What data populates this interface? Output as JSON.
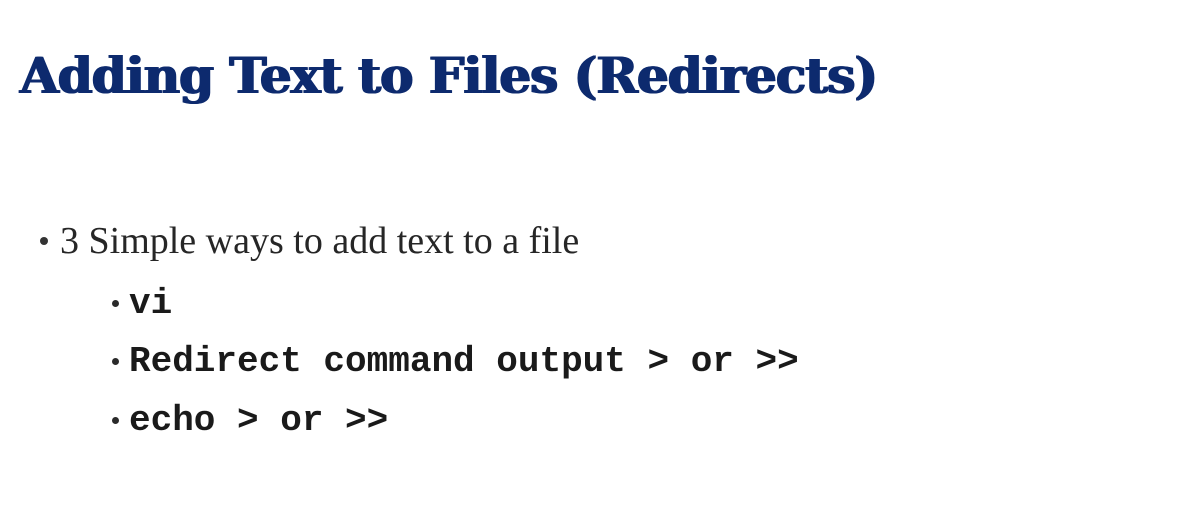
{
  "slide": {
    "title": "Adding Text to Files (Redirects)",
    "title_color": "#0d2a6e",
    "bullets": [
      {
        "text": "3 Simple ways to add text to a file",
        "sub": [
          "vi",
          "Redirect command output > or >>",
          "echo > or >>"
        ]
      }
    ]
  }
}
